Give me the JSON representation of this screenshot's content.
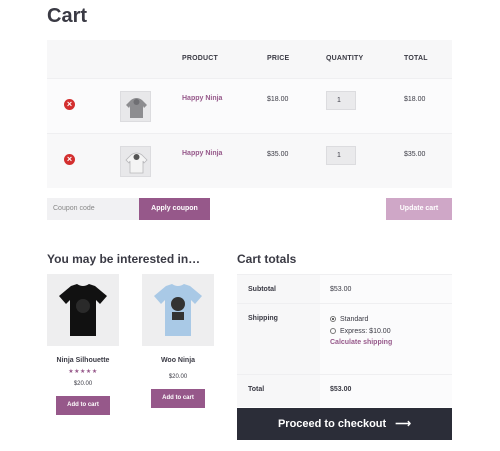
{
  "page": {
    "title": "Cart"
  },
  "cart_table": {
    "headers": {
      "product": "PRODUCT",
      "price": "PRICE",
      "quantity": "QUANTITY",
      "total": "TOTAL"
    },
    "rows": [
      {
        "remove_icon": "remove-circle-icon",
        "thumbnail_icon": "gray-hoodie-thumbnail",
        "name": "Happy Ninja",
        "price": "$18.00",
        "quantity": "1",
        "total": "$18.00"
      },
      {
        "remove_icon": "remove-circle-icon",
        "thumbnail_icon": "white-hoodie-thumbnail",
        "name": "Happy Ninja",
        "price": "$35.00",
        "quantity": "1",
        "total": "$35.00"
      }
    ]
  },
  "coupon": {
    "placeholder": "Coupon code",
    "apply_label": "Apply coupon"
  },
  "update_label": "Update cart",
  "cross_sells": {
    "title": "You may be interested in…",
    "products": [
      {
        "name": "Ninja Silhouette",
        "rating": 5,
        "price": "$20.00",
        "add_label": "Add to cart",
        "image_color": "#111111"
      },
      {
        "name": "Woo Ninja",
        "rating": 0,
        "price": "$20.00",
        "add_label": "Add to cart",
        "image_color": "#a9c9e6"
      }
    ]
  },
  "cart_totals": {
    "title": "Cart totals",
    "subtotal_label": "Subtotal",
    "subtotal_value": "$53.00",
    "shipping_label": "Shipping",
    "shipping_options": [
      {
        "label": "Standard",
        "selected": true
      },
      {
        "label": "Express: $10.00",
        "selected": false
      }
    ],
    "calc_shipping": "Calculate shipping",
    "total_label": "Total",
    "total_value": "$53.00"
  },
  "checkout": {
    "label": "Proceed to checkout",
    "arrow": "⟶"
  },
  "colors": {
    "accent": "#96588a",
    "accent_light": "#cfa7c7",
    "remove": "#d32f2f",
    "checkout_bg": "#2b2d38"
  }
}
